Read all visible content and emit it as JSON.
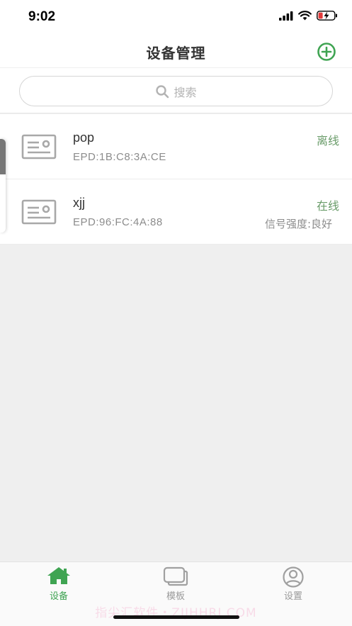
{
  "status_bar": {
    "time": "9:02"
  },
  "nav": {
    "title": "设备管理",
    "add_icon": "plus-circle-icon"
  },
  "search": {
    "placeholder": "搜索"
  },
  "devices": [
    {
      "name": "pop",
      "id": "EPD:1B:C8:3A:CE",
      "status": "离线",
      "signal": ""
    },
    {
      "name": "xjj",
      "id": "EPD:96:FC:4A:88",
      "status": "在线",
      "signal": "信号强度:良好"
    }
  ],
  "tabs": [
    {
      "label": "设备",
      "icon": "home-icon",
      "active": true
    },
    {
      "label": "模板",
      "icon": "template-icon",
      "active": false
    },
    {
      "label": "设置",
      "icon": "user-icon",
      "active": false
    }
  ],
  "watermark": "指尖汇软件・ZIJHHRJ.COM",
  "colors": {
    "accent_green": "#3fa452",
    "status_green": "#6a9c6a",
    "background": "#efefef"
  }
}
